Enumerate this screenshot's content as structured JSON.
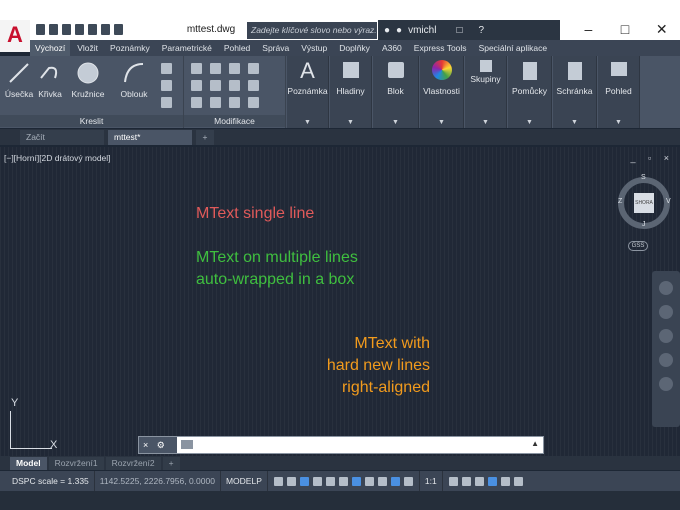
{
  "app": {
    "logo_letter": "A",
    "document_title": "mttest.dwg",
    "search_placeholder": "Zadejte klíčové slovo nebo výraz.",
    "user_name": "vmichl",
    "help_label": "?"
  },
  "ribbon_tabs": [
    "Výchozí",
    "Vložit",
    "Poznámky",
    "Parametrické",
    "Pohled",
    "Správa",
    "Výstup",
    "Doplňky",
    "A360",
    "Express Tools",
    "Speciální aplikace"
  ],
  "ribbon": {
    "draw_panel": {
      "title": "Kreslit",
      "tools": [
        "Úsečka",
        "Křivka",
        "Kružnice",
        "Oblouk"
      ]
    },
    "modify_panel": {
      "title": "Modifikace"
    },
    "big_tools": [
      "Poznámka",
      "Hladiny",
      "Blok",
      "Vlastnosti",
      "Skupiny",
      "Pomůcky",
      "Schránka",
      "Pohled"
    ]
  },
  "file_tabs": {
    "start": "Začít",
    "current": "mttest*",
    "add": "+"
  },
  "viewport": {
    "controls_label": "[−][Horní][2D drátový model]",
    "window_buttons": "_ ▫ ×",
    "mtext_single": "MText single line",
    "mtext_multi": [
      "MText on multiple lines",
      "auto-wrapped in a box"
    ],
    "mtext_right": [
      "MText with",
      "hard new lines",
      "right-aligned"
    ],
    "viewcube": {
      "face": "SHORA",
      "n": "S",
      "s": "J",
      "w": "Z",
      "e": "V"
    },
    "gss": "GSS",
    "ucs": {
      "x": "X",
      "y": "Y"
    }
  },
  "command_line": {
    "close": "×",
    "wrench": "🔧",
    "value": ""
  },
  "layout_tabs": [
    "Model",
    "Rozvržení1",
    "Rozvržení2",
    "+"
  ],
  "status": {
    "dspc": "DSPC scale = 1.335",
    "coords": "1142.5225, 2226.7956, 0.0000",
    "mode": "MODELP",
    "scale": "1:1"
  },
  "colors": {
    "red_text": "#e05a5a",
    "green_text": "#3fbf3f",
    "orange_text": "#f29b1d",
    "background": "#202836"
  }
}
